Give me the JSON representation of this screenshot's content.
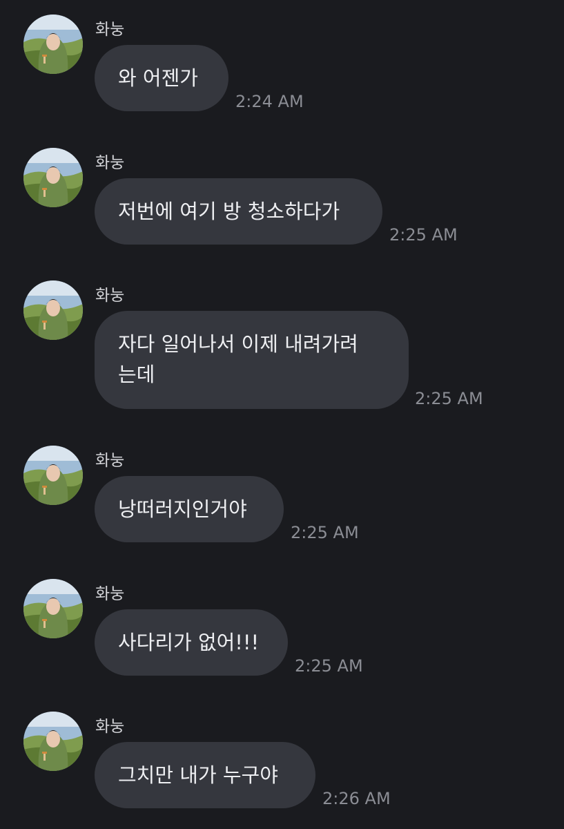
{
  "sender_name": "화눙",
  "colors": {
    "background": "#1a1b1f",
    "bubble": "#35373e",
    "text": "#eeeff2",
    "timestamp": "#8b8d94"
  },
  "messages": [
    {
      "text": "와 어젠가",
      "time": "2:24 AM"
    },
    {
      "text": "저번에 여기 방 청소하다가",
      "time": "2:25 AM"
    },
    {
      "lines": [
        "자다 일어나서 이제 내려가려",
        "는데"
      ],
      "time": "2:25 AM"
    },
    {
      "text": "낭떠러지인거야",
      "time": "2:25 AM"
    },
    {
      "text": "사다리가 없어!!!",
      "time": "2:25 AM"
    },
    {
      "text": "그치만 내가 누구야",
      "time": "2:26 AM"
    }
  ]
}
